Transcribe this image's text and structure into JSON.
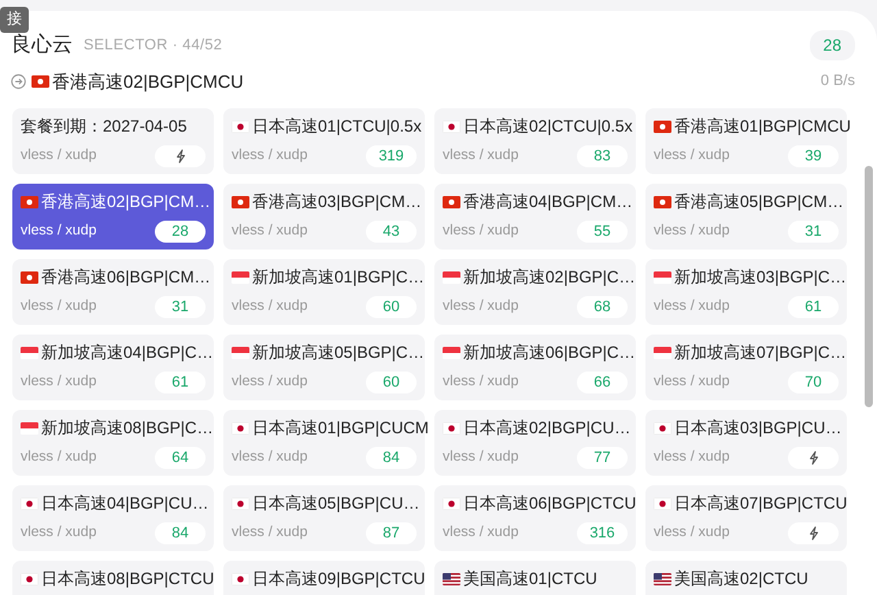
{
  "tooltip": {
    "text": "接"
  },
  "group": {
    "name": "良心云",
    "meta": "SELECTOR · 44/52",
    "delay": "28"
  },
  "current": {
    "kind": "hk",
    "name": "香港高速02|BGP|CMCU",
    "speed": "0 B/s"
  },
  "proxies": [
    {
      "name": "套餐到期：2027-04-05",
      "protocol": "vless / xudp",
      "selected": false
    },
    {
      "kind": "jp",
      "name": "日本高速01|CTCU|0.5x",
      "protocol": "vless / xudp",
      "delay": "319",
      "selected": false
    },
    {
      "kind": "jp",
      "name": "日本高速02|CTCU|0.5x",
      "protocol": "vless / xudp",
      "delay": "83",
      "selected": false
    },
    {
      "kind": "hk",
      "name": "香港高速01|BGP|CMCU",
      "protocol": "vless / xudp",
      "delay": "39",
      "selected": false
    },
    {
      "kind": "hk",
      "name": "香港高速02|BGP|CM…",
      "protocol": "vless / xudp",
      "delay": "28",
      "selected": true
    },
    {
      "kind": "hk",
      "name": "香港高速03|BGP|CM…",
      "protocol": "vless / xudp",
      "delay": "43",
      "selected": false
    },
    {
      "kind": "hk",
      "name": "香港高速04|BGP|CM…",
      "protocol": "vless / xudp",
      "delay": "55",
      "selected": false
    },
    {
      "kind": "hk",
      "name": "香港高速05|BGP|CM…",
      "protocol": "vless / xudp",
      "delay": "31",
      "selected": false
    },
    {
      "kind": "hk",
      "name": "香港高速06|BGP|CM…",
      "protocol": "vless / xudp",
      "delay": "31",
      "selected": false
    },
    {
      "kind": "sg",
      "name": "新加坡高速01|BGP|C…",
      "protocol": "vless / xudp",
      "delay": "60",
      "selected": false
    },
    {
      "kind": "sg",
      "name": "新加坡高速02|BGP|C…",
      "protocol": "vless / xudp",
      "delay": "68",
      "selected": false
    },
    {
      "kind": "sg",
      "name": "新加坡高速03|BGP|C…",
      "protocol": "vless / xudp",
      "delay": "61",
      "selected": false
    },
    {
      "kind": "sg",
      "name": "新加坡高速04|BGP|C…",
      "protocol": "vless / xudp",
      "delay": "61",
      "selected": false
    },
    {
      "kind": "sg",
      "name": "新加坡高速05|BGP|C…",
      "protocol": "vless / xudp",
      "delay": "60",
      "selected": false
    },
    {
      "kind": "sg",
      "name": "新加坡高速06|BGP|C…",
      "protocol": "vless / xudp",
      "delay": "66",
      "selected": false
    },
    {
      "kind": "sg",
      "name": "新加坡高速07|BGP|C…",
      "protocol": "vless / xudp",
      "delay": "70",
      "selected": false
    },
    {
      "kind": "sg",
      "name": "新加坡高速08|BGP|C…",
      "protocol": "vless / xudp",
      "delay": "64",
      "selected": false
    },
    {
      "kind": "jp",
      "name": "日本高速01|BGP|CUCM",
      "protocol": "vless / xudp",
      "delay": "84",
      "selected": false
    },
    {
      "kind": "jp",
      "name": "日本高速02|BGP|CU…",
      "protocol": "vless / xudp",
      "delay": "77",
      "selected": false
    },
    {
      "kind": "jp",
      "name": "日本高速03|BGP|CU…",
      "protocol": "vless / xudp",
      "selected": false
    },
    {
      "kind": "jp",
      "name": "日本高速04|BGP|CU…",
      "protocol": "vless / xudp",
      "delay": "84",
      "selected": false
    },
    {
      "kind": "jp",
      "name": "日本高速05|BGP|CU…",
      "protocol": "vless / xudp",
      "delay": "87",
      "selected": false
    },
    {
      "kind": "jp",
      "name": "日本高速06|BGP|CTCU",
      "protocol": "vless / xudp",
      "delay": "316",
      "selected": false
    },
    {
      "kind": "jp",
      "name": "日本高速07|BGP|CTCU",
      "protocol": "vless / xudp",
      "selected": false
    },
    {
      "kind": "jp",
      "name": "日本高速08|BGP|CTCU",
      "selected": false
    },
    {
      "kind": "jp",
      "name": "日本高速09|BGP|CTCU",
      "selected": false
    },
    {
      "kind": "us",
      "name": "美国高速01|CTCU",
      "selected": false
    },
    {
      "kind": "us",
      "name": "美国高速02|CTCU",
      "selected": false
    }
  ]
}
